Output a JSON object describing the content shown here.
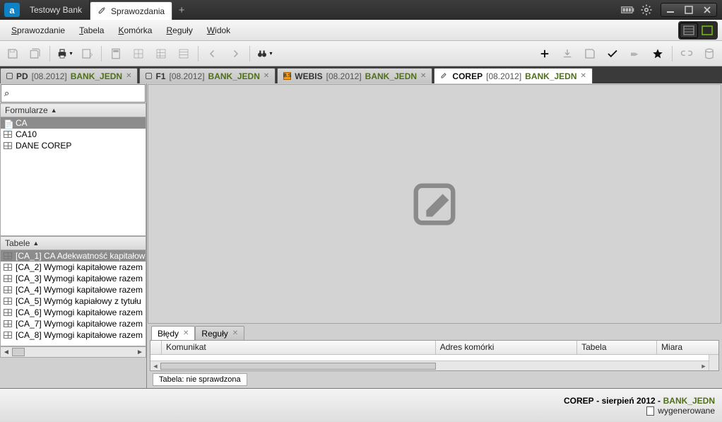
{
  "titlebar": {
    "app_letter": "a",
    "tab1": "Testowy Bank",
    "tab2": "Sprawozdania"
  },
  "menu": {
    "items": [
      "Sprawozdanie",
      "Tabela",
      "Komórka",
      "Reguły",
      "Widok"
    ]
  },
  "doctabs": [
    {
      "code": "PD",
      "date": "[08.2012]",
      "type": "BANK_JEDN",
      "active": false,
      "icontype": "box"
    },
    {
      "code": "F1",
      "date": "[08.2012]",
      "type": "BANK_JEDN",
      "active": false,
      "icontype": "box"
    },
    {
      "code": "WEBIS",
      "date": "[08.2012]",
      "type": "BANK_JEDN",
      "active": false,
      "icontype": "orange"
    },
    {
      "code": "COREP",
      "date": "[08.2012]",
      "type": "BANK_JEDN",
      "active": true,
      "icontype": "edit"
    }
  ],
  "sidebar": {
    "formularz_label": "Formularze",
    "formul_items": [
      {
        "label": "CA",
        "selected": true
      },
      {
        "label": "CA10",
        "selected": false
      },
      {
        "label": "DANE COREP",
        "selected": false
      }
    ],
    "tabele_label": "Tabele",
    "tabele_items": [
      {
        "label": "[CA_1] CA Adekwatność kapitałow",
        "selected": true
      },
      {
        "label": "[CA_2] Wymogi kapitałowe razem",
        "selected": false
      },
      {
        "label": "[CA_3] Wymogi kapitałowe razem",
        "selected": false
      },
      {
        "label": "[CA_4] Wymogi kapitałowe razem",
        "selected": false
      },
      {
        "label": "[CA_5] Wymóg kapiałowy z tytułu",
        "selected": false
      },
      {
        "label": "[CA_6] Wymogi kapitałowe razem",
        "selected": false
      },
      {
        "label": "[CA_7] Wymogi kapitałowe razem",
        "selected": false
      },
      {
        "label": "[CA_8] Wymogi kapitałowe razem",
        "selected": false
      }
    ]
  },
  "bottom_tabs": {
    "bledy": "Błędy",
    "reguly": "Reguły"
  },
  "grid_columns": {
    "komunikat": "Komunikat",
    "adres": "Adres komórki",
    "tabela": "Tabela",
    "miara": "Miara"
  },
  "status_chip": "Tabela: nie sprawdzona",
  "footer": {
    "left": "COREP",
    "mid": "- sierpień 2012 -",
    "bank": "BANK_JEDN",
    "gen": "wygenerowane"
  }
}
